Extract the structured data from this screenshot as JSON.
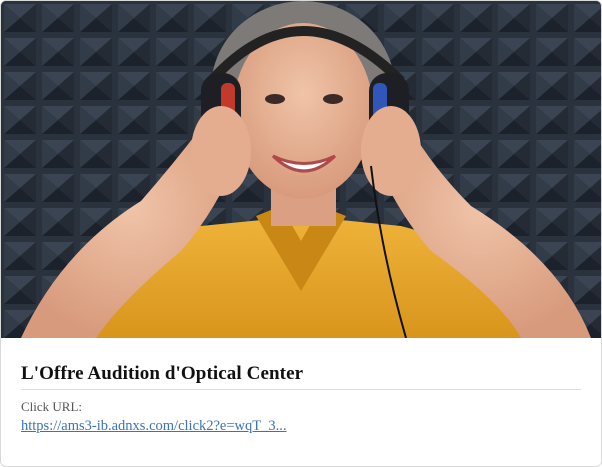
{
  "card": {
    "image_alt": "Smiling woman wearing headphones in an acoustic foam studio",
    "title": "L'Offre Audition d'Optical Center",
    "click_label": "Click URL:",
    "click_url": "https://ams3-ib.adnxs.com/click2?e=wqT_3..."
  },
  "colors": {
    "link": "#3b73b9",
    "foam": "#2b3440",
    "shirt": "#e3a526"
  }
}
